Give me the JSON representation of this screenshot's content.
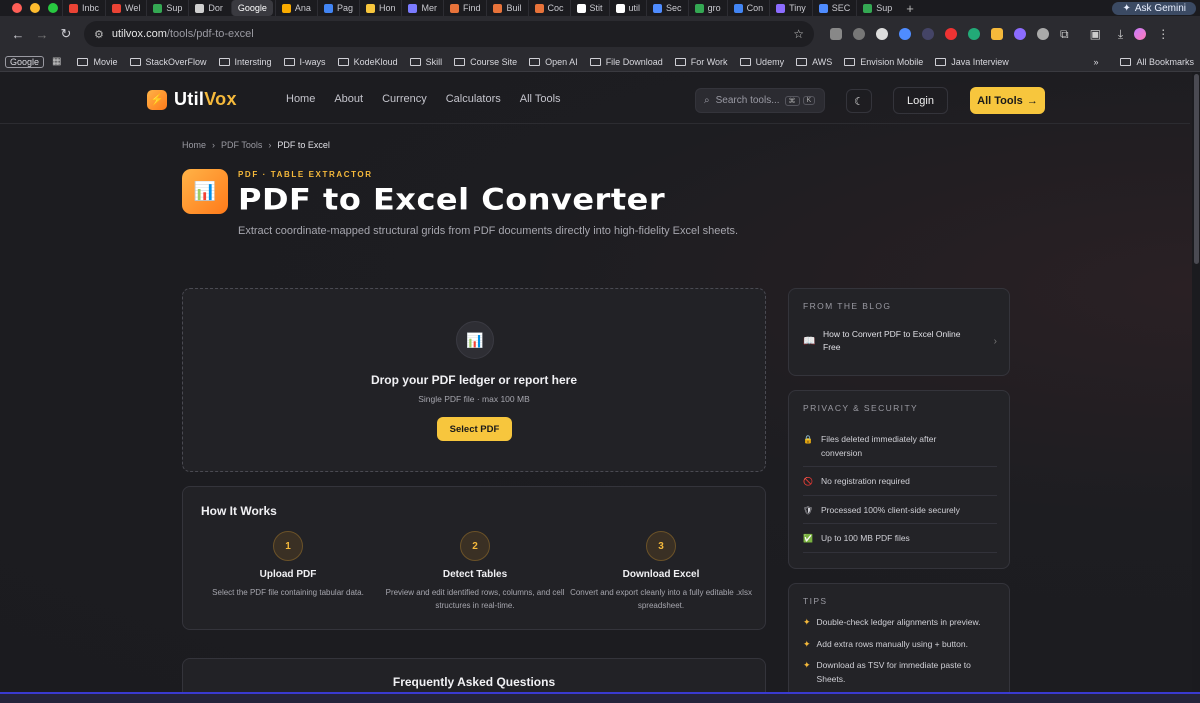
{
  "browser": {
    "tabs": [
      {
        "label": "Inbc",
        "color": "#ea4335"
      },
      {
        "label": "Wel",
        "color": "#ea4335"
      },
      {
        "label": "Sup",
        "color": "#34a853"
      },
      {
        "label": "Dor",
        "color": "#cfcfcf"
      },
      {
        "label": "Google",
        "color": "#ffffff",
        "active": true
      },
      {
        "label": "Ana",
        "color": "#f9ab00"
      },
      {
        "label": "Pag",
        "color": "#4285f4"
      },
      {
        "label": "Hon",
        "color": "#f7c63d"
      },
      {
        "label": "Mer",
        "color": "#7b7bff"
      },
      {
        "label": "Find",
        "color": "#e8733a"
      },
      {
        "label": "Buil",
        "color": "#e8733a"
      },
      {
        "label": "Coc",
        "color": "#e8733a"
      },
      {
        "label": "Stit",
        "color": "#ffffff"
      },
      {
        "label": "util",
        "color": "#ffffff"
      },
      {
        "label": "Sec",
        "color": "#4f8cff"
      },
      {
        "label": "gro",
        "color": "#34a853"
      },
      {
        "label": "Con",
        "color": "#4285f4"
      },
      {
        "label": "Tiny",
        "color": "#8c6cff"
      },
      {
        "label": "SEC",
        "color": "#4f8cff"
      },
      {
        "label": "Sup",
        "color": "#34a853"
      }
    ],
    "new_tab": "+",
    "gemini_label": "Ask Gemini",
    "url_host": "utilvox.com",
    "url_path": "/tools/pdf-to-excel",
    "bookmarks": [
      "Movie",
      "StackOverFlow",
      "Intersting",
      "I-ways",
      "KodeKloud",
      "Skill",
      "Course Site",
      "Open AI",
      "File Download",
      "For Work",
      "Udemy",
      "AWS",
      "Envision Mobile",
      "Java Interview"
    ],
    "google_chip": "Google",
    "all_bookmarks": "All Bookmarks"
  },
  "site": {
    "logo_util": "Util",
    "logo_vox": "Vox",
    "nav": [
      "Home",
      "About",
      "Currency",
      "Calculators",
      "All Tools"
    ],
    "search_placeholder": "Search tools...",
    "search_kbd1": "⌘",
    "search_kbd2": "K",
    "login": "Login",
    "all_tools_btn": "All Tools",
    "breadcrumbs": [
      "Home",
      "PDF Tools",
      "PDF to Excel"
    ],
    "eyebrow": "PDF · TABLE EXTRACTOR",
    "title": "PDF to Excel Converter",
    "subtitle": "Extract coordinate-mapped structural grids from PDF documents directly into high-fidelity Excel sheets."
  },
  "dropzone": {
    "title": "Drop your PDF ledger or report here",
    "subtitle": "Single PDF file · max 100 MB",
    "button": "Select PDF"
  },
  "how": {
    "title": "How It Works",
    "steps": [
      {
        "num": "1",
        "title": "Upload PDF",
        "desc": "Select the PDF file containing tabular data."
      },
      {
        "num": "2",
        "title": "Detect Tables",
        "desc": "Preview and edit identified rows, columns, and cell structures in real-time."
      },
      {
        "num": "3",
        "title": "Download Excel",
        "desc": "Convert and export cleanly into a fully editable .xlsx spreadsheet."
      }
    ]
  },
  "faq": {
    "title": "Frequently Asked Questions"
  },
  "blog": {
    "title": "FROM THE BLOG",
    "item": "How to Convert PDF to Excel Online Free"
  },
  "privacy": {
    "title": "PRIVACY & SECURITY",
    "items": [
      {
        "icon": "🔒",
        "text": "Files deleted immediately after conversion"
      },
      {
        "icon": "🚫",
        "text": "No registration required"
      },
      {
        "icon": "🛡",
        "text": "Processed 100% client-side securely"
      },
      {
        "icon": "✅",
        "text": "Up to 100 MB PDF files"
      }
    ]
  },
  "tips": {
    "title": "TIPS",
    "items": [
      "Double-check ledger alignments in preview.",
      "Add extra rows manually using + button.",
      "Download as TSV for immediate paste to Sheets."
    ]
  },
  "colors": {
    "accent": "#f7c63d",
    "bg": "#1b1b1f",
    "card": "#222226"
  }
}
